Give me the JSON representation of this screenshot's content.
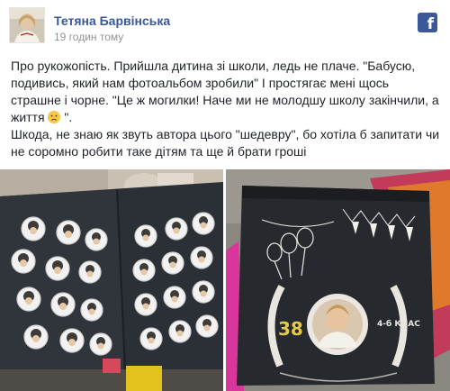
{
  "post": {
    "author": "Тетяна Барвінська",
    "timestamp": "19 годин тому",
    "network_icon": "facebook-f-icon",
    "paragraphs": [
      "Про рукожопість. Прийшла дитина зі школи, ледь не плаче. \"Бабусю, подивись, який нам фотоальбом зробили\" І простягає мені щось страшне і чорне. \"Це ж могилки! Наче ми не молодшу школу закінчили, а життя",
      "Шкода, не знаю як звуть автора цього \"шедевру\", бо хотіла б запитати чи не соромно робити таке дітям та ще й брати гроші"
    ],
    "emoji_name": "disappointed-face-emoji",
    "emoji_suffix": " \"."
  },
  "photos": {
    "right_album": {
      "number": "38",
      "class_label": "4-б КЛАС"
    }
  },
  "colors": {
    "link": "#385898",
    "facebook_blue": "#3b5998",
    "meta_gray": "#90949c",
    "text": "#1d2129"
  }
}
